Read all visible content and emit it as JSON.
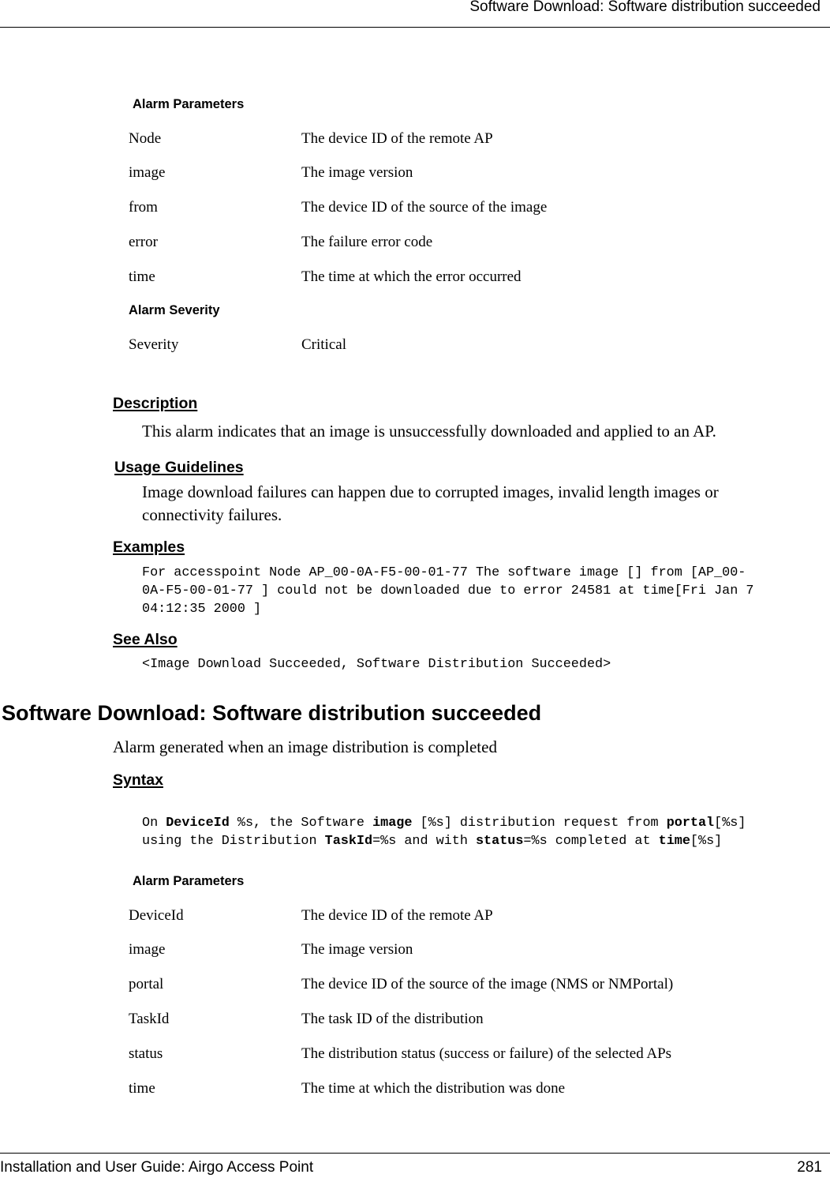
{
  "header": {
    "title": "Software Download: Software distribution succeeded"
  },
  "section1": {
    "params_heading": "Alarm Parameters",
    "params": [
      {
        "name": "Node",
        "desc": "The device ID of the remote AP"
      },
      {
        "name": "image",
        "desc": "The image version"
      },
      {
        "name": "from",
        "desc": "The device ID of the source of the image"
      },
      {
        "name": "error",
        "desc": "The failure error code"
      },
      {
        "name": "time",
        "desc": "The time at which the error occurred"
      }
    ],
    "severity_heading": "Alarm Severity",
    "severity": {
      "name": "Severity",
      "value": "Critical"
    },
    "description_heading": "Description",
    "description": "This alarm indicates that an image is unsuccessfully downloaded and applied to an AP.",
    "usage_heading": "Usage Guidelines",
    "usage_line1": "Image download failures can happen due to corrupted images, invalid length images or",
    "usage_line2": "connectivity failures.",
    "examples_heading": "Examples",
    "example_lines": [
      "For accesspoint Node AP_00-0A-F5-00-01-77 The software image [] from [AP_00-",
      "0A-F5-00-01-77 ] could not be downloaded due to error 24581 at time[Fri Jan 7",
      "04:12:35 2000 ]"
    ],
    "see_also_heading": "See Also",
    "see_also": "<Image Download Succeeded, Software Distribution Succeeded>"
  },
  "section2": {
    "title": "Software Download: Software distribution succeeded",
    "summary": "Alarm generated when an image distribution is completed",
    "syntax_heading": "Syntax",
    "syntax_line1": [
      {
        "t": "On ",
        "b": false
      },
      {
        "t": "DeviceId",
        "b": true
      },
      {
        "t": " %s, the Software ",
        "b": false
      },
      {
        "t": "image",
        "b": true
      },
      {
        "t": " [%s] distribution request from ",
        "b": false
      },
      {
        "t": "portal",
        "b": true
      },
      {
        "t": "[%s]",
        "b": false
      }
    ],
    "syntax_line2": [
      {
        "t": "using the Distribution ",
        "b": false
      },
      {
        "t": "TaskId",
        "b": true
      },
      {
        "t": "=%s and with ",
        "b": false
      },
      {
        "t": "status",
        "b": true
      },
      {
        "t": "=%s completed at ",
        "b": false
      },
      {
        "t": "time",
        "b": true
      },
      {
        "t": "[%s]",
        "b": false
      }
    ],
    "params_heading": "Alarm Parameters",
    "params": [
      {
        "name": "DeviceId",
        "desc": "The device ID of the remote AP"
      },
      {
        "name": "image",
        "desc": "The image version"
      },
      {
        "name": "portal",
        "desc": "The device ID of the source of the image (NMS or NMPortal)"
      },
      {
        "name": "TaskId",
        "desc": "The task ID of the distribution"
      },
      {
        "name": "status",
        "desc": "The distribution status (success or failure) of the selected APs"
      },
      {
        "name": "time",
        "desc": "The time at which the distribution was done"
      }
    ]
  },
  "footer": {
    "left": "Installation and User Guide: Airgo Access Point",
    "page_number": "281"
  }
}
